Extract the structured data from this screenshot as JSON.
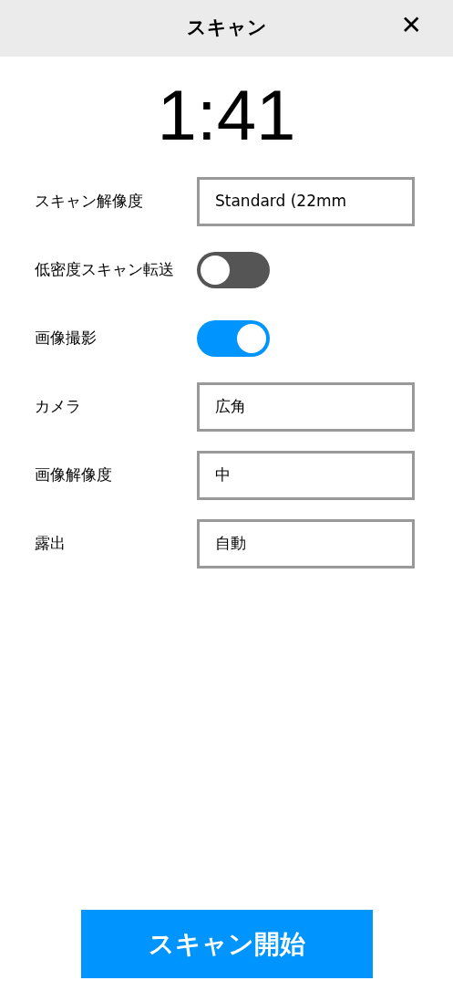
{
  "header": {
    "title": "スキャン",
    "close": "✕"
  },
  "timer": "1:41",
  "settings": [
    {
      "kind": "field",
      "label": "スキャン解像度",
      "value": "Standard (22mm"
    },
    {
      "kind": "toggle",
      "label": "低密度スキャン転送",
      "on": false
    },
    {
      "kind": "toggle",
      "label": "画像撮影",
      "on": true
    },
    {
      "kind": "field",
      "label": "カメラ",
      "value": "広角"
    },
    {
      "kind": "field",
      "label": "画像解像度",
      "value": "中"
    },
    {
      "kind": "field",
      "label": "露出",
      "value": "自動"
    }
  ],
  "start_button": "スキャン開始"
}
